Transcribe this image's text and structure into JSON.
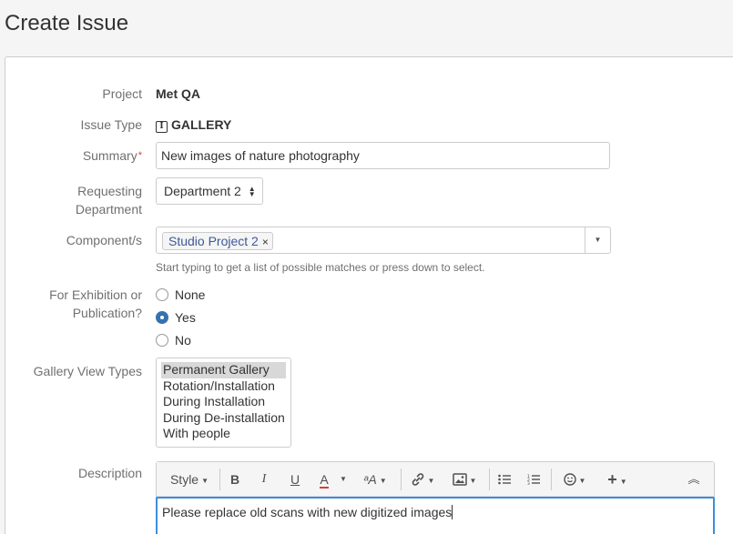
{
  "page": {
    "title": "Create Issue"
  },
  "form": {
    "project": {
      "label": "Project",
      "value": "Met QA"
    },
    "issue_type": {
      "label": "Issue Type",
      "icon": "issue-type-icon",
      "icon_glyph": "I",
      "value": "GALLERY"
    },
    "summary": {
      "label": "Summary",
      "required_mark": "*",
      "value": "New images of nature photography"
    },
    "requesting_department": {
      "label_line1": "Requesting",
      "label_line2": "Department",
      "selected": "Department 2"
    },
    "components": {
      "label": "Component/s",
      "chips": [
        {
          "label": "Studio Project 2",
          "remove": "×"
        }
      ],
      "help": "Start typing to get a list of possible matches or press down to select."
    },
    "exhibition": {
      "label_line1": "For Exhibition or",
      "label_line2": "Publication?",
      "options": [
        {
          "label": "None",
          "checked": false
        },
        {
          "label": "Yes",
          "checked": true
        },
        {
          "label": "No",
          "checked": false
        }
      ]
    },
    "gallery_view_types": {
      "label": "Gallery View Types",
      "options": [
        {
          "label": "Permanent Gallery",
          "selected": true
        },
        {
          "label": "Rotation/Installation",
          "selected": false
        },
        {
          "label": "During Installation",
          "selected": false
        },
        {
          "label": "During De-installation",
          "selected": false
        },
        {
          "label": "With people",
          "selected": false
        }
      ]
    },
    "description": {
      "label": "Description",
      "toolbar": {
        "style_label": "Style",
        "bold": "B",
        "italic": "I",
        "underline": "U",
        "text_color": "A",
        "text_effects": "ᵃA",
        "accent_color": "#d04437"
      },
      "content": "Please replace old scans with new digitized images"
    }
  }
}
